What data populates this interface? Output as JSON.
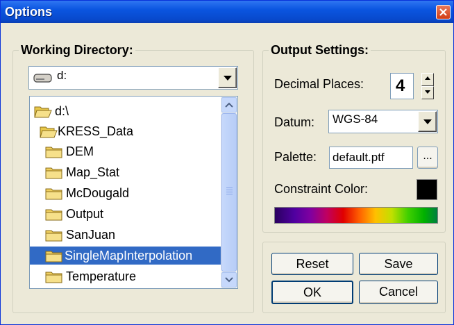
{
  "window": {
    "title": "Options"
  },
  "working_directory": {
    "title": "Working Directory:",
    "drive": "d:",
    "tree": [
      {
        "label": "d:\\",
        "icon": "open-folder-icon",
        "selected": false
      },
      {
        "label": "KRESS_Data",
        "icon": "open-folder-icon",
        "selected": false
      },
      {
        "label": "DEM",
        "icon": "folder-icon",
        "selected": false
      },
      {
        "label": "Map_Stat",
        "icon": "folder-icon",
        "selected": false
      },
      {
        "label": "McDougald",
        "icon": "folder-icon",
        "selected": false
      },
      {
        "label": "Output",
        "icon": "folder-icon",
        "selected": false
      },
      {
        "label": "SanJuan",
        "icon": "folder-icon",
        "selected": false
      },
      {
        "label": "SingleMapInterpolation",
        "icon": "folder-icon",
        "selected": true
      },
      {
        "label": "Temperature",
        "icon": "folder-icon",
        "selected": false
      }
    ]
  },
  "output_settings": {
    "title": "Output Settings:",
    "decimal_places_label": "Decimal Places:",
    "decimal_places_value": "4",
    "datum_label": "Datum:",
    "datum_value": "WGS-84",
    "palette_label": "Palette:",
    "palette_value": "default.ptf",
    "browse_label": "...",
    "constraint_color_label": "Constraint Color:",
    "constraint_color": "#000000"
  },
  "buttons": {
    "reset": "Reset",
    "save": "Save",
    "ok": "OK",
    "cancel": "Cancel"
  },
  "colors": {
    "titlebar": "#0a55e0",
    "dialog_bg": "#ece9d8",
    "selection": "#316ac5"
  }
}
